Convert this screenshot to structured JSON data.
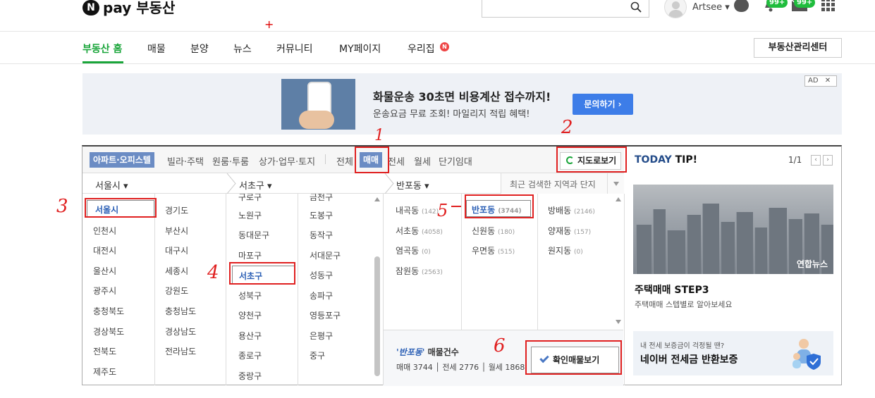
{
  "header": {
    "logo_n": "N",
    "logo_text": "pay 부동산",
    "username": "Artsee",
    "notif_badge": "99+",
    "mail_badge": "99+"
  },
  "nav": {
    "items": [
      "부동산 홈",
      "매물",
      "분양",
      "뉴스",
      "커뮤니티",
      "MY페이지",
      "우리집"
    ],
    "new_badge": "N",
    "center_button": "부동산관리센터"
  },
  "ad": {
    "title": "화물운송 30초면 비용계산 접수까지!",
    "subtitle": "운송요금 무료 조회! 마일리지 적립 혜택!",
    "button": "문의하기 ›",
    "label": "AD",
    "close": "✕"
  },
  "search": {
    "property_types": [
      "아파트·오피스텔",
      "빌라·주택",
      "원룸·투룸",
      "상가·업무·토지"
    ],
    "deal_types": [
      "전체",
      "매매",
      "전세",
      "월세",
      "단기임대"
    ],
    "map_button": "지도로보기",
    "dropdowns": {
      "city": "서울시",
      "district": "서초구",
      "dong": "반포동"
    },
    "recent": "최근 검색한 지역과 단지",
    "cities_col1": [
      "서울시",
      "인천시",
      "대전시",
      "울산시",
      "광주시",
      "충청북도",
      "경상북도",
      "전북도",
      "제주도"
    ],
    "cities_col2": [
      "경기도",
      "부산시",
      "대구시",
      "세종시",
      "강원도",
      "충청남도",
      "경상남도",
      "전라남도"
    ],
    "districts_col1": [
      "구로구",
      "노원구",
      "동대문구",
      "마포구",
      "서초구",
      "성북구",
      "양천구",
      "용산구",
      "종로구",
      "중랑구"
    ],
    "districts_col2": [
      "금천구",
      "도봉구",
      "동작구",
      "서대문구",
      "성동구",
      "송파구",
      "영등포구",
      "은평구",
      "중구"
    ],
    "dongs_col1": [
      {
        "name": "내곡동",
        "count": "(142)"
      },
      {
        "name": "서초동",
        "count": "(4058)"
      },
      {
        "name": "염곡동",
        "count": "(0)"
      },
      {
        "name": "잠원동",
        "count": "(2563)"
      }
    ],
    "dongs_col2": [
      {
        "name": "반포동",
        "count": "(3744)"
      },
      {
        "name": "신원동",
        "count": "(180)"
      },
      {
        "name": "우면동",
        "count": "(515)"
      }
    ],
    "dongs_col3": [
      {
        "name": "방배동",
        "count": "(2146)"
      },
      {
        "name": "양재동",
        "count": "(157)"
      },
      {
        "name": "원지동",
        "count": "(0)"
      }
    ],
    "result": {
      "dong": "'반포동'",
      "label": "매물건수",
      "counts": "매매 3744 │ 전세 2776 │ 월세 1868",
      "button": "확인매물보기"
    }
  },
  "tip": {
    "title_today": "TODAY",
    "title_tip": "TIP!",
    "page": "1/1",
    "prev": "‹",
    "next": "›",
    "photo_credit": "연합뉴스",
    "headline": "주택매매 STEP3",
    "description": "주택매매 스텝별로 알아보세요",
    "banner_small": "내 전세 보증금이 걱정될 땐?",
    "banner_big": "네이버 전세금 반환보증"
  },
  "annotations": [
    "1",
    "2",
    "3",
    "4",
    "5",
    "6",
    "+"
  ]
}
